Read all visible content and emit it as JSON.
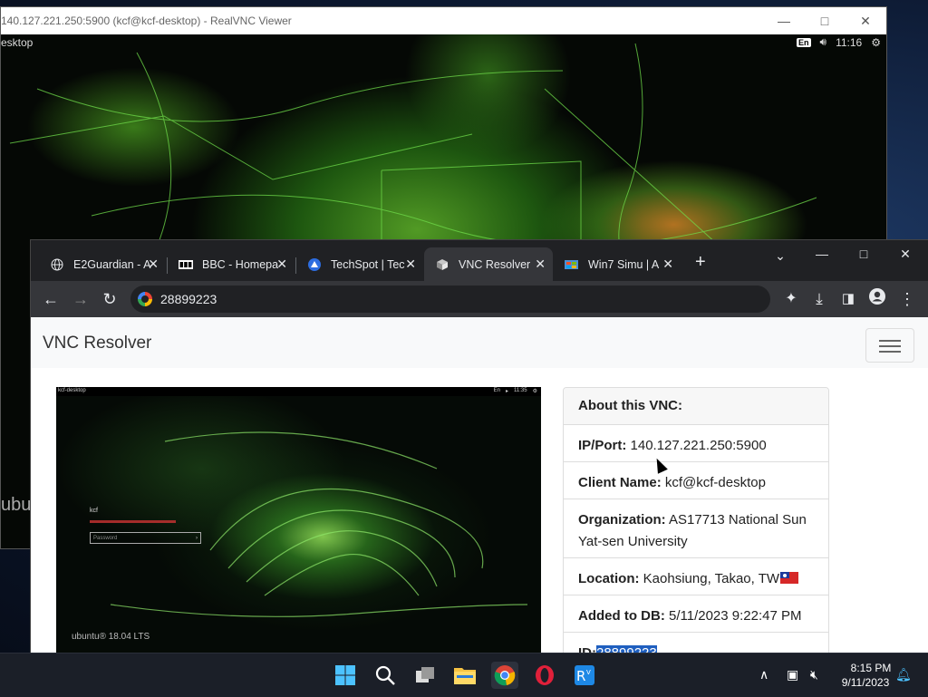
{
  "vnc_viewer": {
    "title": "140.127.221.250:5900 (kcf@kcf-desktop) - RealVNC Viewer",
    "remote_desktop_label": "esktop",
    "tray_lang": "En",
    "tray_time": "11:16",
    "partial_text": "ubu"
  },
  "browser": {
    "tabs": [
      {
        "title": "E2Guardian - A",
        "active": false,
        "icon": "globe-icon"
      },
      {
        "title": "BBC - Homepa",
        "active": false,
        "icon": "bbc-icon"
      },
      {
        "title": "TechSpot | Tec",
        "active": false,
        "icon": "techspot-icon"
      },
      {
        "title": "VNC Resolver",
        "active": true,
        "icon": "vnc-resolver-icon"
      },
      {
        "title": "Win7 Simu | A",
        "active": false,
        "icon": "win7-icon"
      }
    ],
    "address": "28899223"
  },
  "page": {
    "brand": "VNC Resolver",
    "screenshot": {
      "host": "kcf-desktop",
      "tray_lang": "En",
      "tray_time": "11:35",
      "username": "kcf",
      "password_placeholder": "Password",
      "os_label": "ubuntu® 18.04 LTS"
    },
    "info": {
      "header": "About this VNC:",
      "ip_label": "IP/Port:",
      "ip_value": "140.127.221.250:5900",
      "client_label": "Client Name:",
      "client_value": "kcf@kcf-desktop",
      "org_label": "Organization:",
      "org_value": "AS17713 National Sun Yat-sen University",
      "location_label": "Location:",
      "location_value": "Kaohsiung, Takao, TW",
      "added_label": "Added to DB:",
      "added_value": "5/11/2023 9:22:47 PM",
      "id_label": "ID:",
      "id_value": "28899223"
    }
  },
  "taskbar": {
    "time": "8:15 PM",
    "date": "9/11/2023"
  }
}
